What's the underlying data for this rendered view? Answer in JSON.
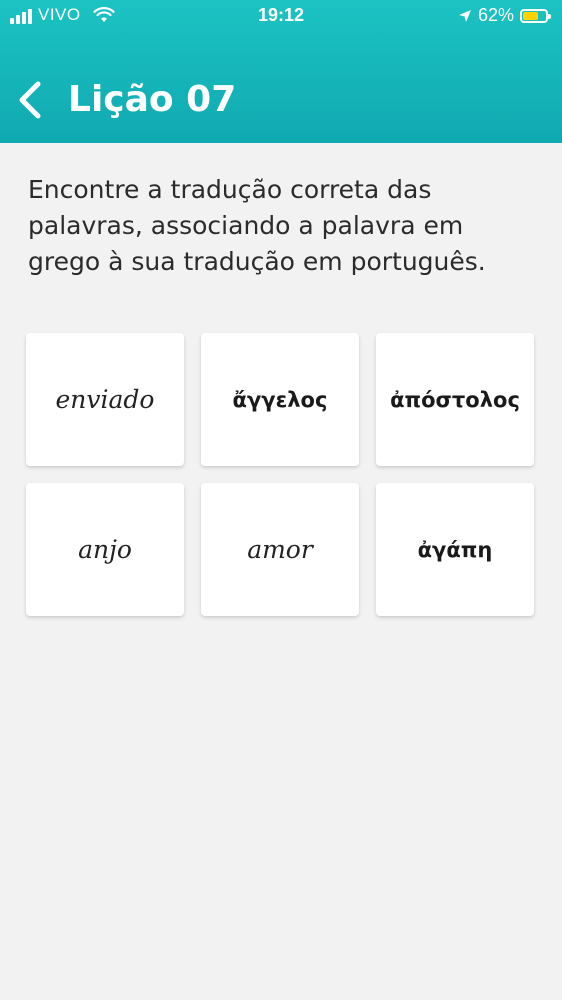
{
  "status_bar": {
    "carrier": "VIVO",
    "time": "19:12",
    "battery": "62%",
    "battery_level": 0.62,
    "battery_color": "#ffd200"
  },
  "nav": {
    "back_icon": "chevron-left-icon",
    "title": "Lição 07"
  },
  "instructions": "Encontre a tradução correta das palavras, associando a palavra em grego à sua tradução em português.",
  "cards": [
    {
      "text": "enviado",
      "lang": "pt"
    },
    {
      "text": "ἄγγελος",
      "lang": "gr"
    },
    {
      "text": "ἀπόστολος",
      "lang": "gr"
    },
    {
      "text": "anjo",
      "lang": "pt"
    },
    {
      "text": "amor",
      "lang": "pt"
    },
    {
      "text": "ἀγάπη",
      "lang": "gr"
    }
  ],
  "colors": {
    "header_top": "#1cc3c3",
    "header_bottom": "#10a9b1",
    "background": "#f2f2f2"
  }
}
